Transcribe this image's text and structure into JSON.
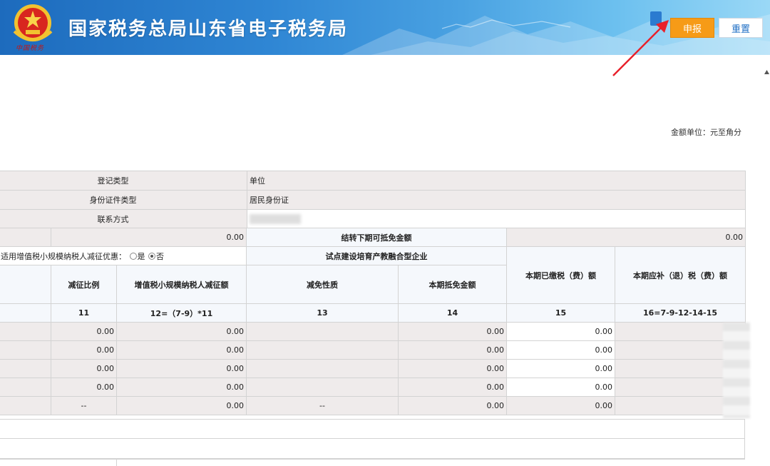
{
  "header": {
    "site_title": "国家税务总局山东省电子税务局",
    "brand_script": "中国税务",
    "submit_label": "申报",
    "reset_label": "重置"
  },
  "unit_label": "金额单位：元至角分",
  "info": {
    "rows": [
      {
        "label": "登记类型",
        "value": "单位"
      },
      {
        "label": "身份证件类型",
        "value": "居民身份证"
      },
      {
        "label": "联系方式",
        "value": ""
      }
    ]
  },
  "main": {
    "row1_value": "0.00",
    "carry_over_label": "结转下期可抵免金额",
    "carry_over_value": "0.00",
    "vat_small_label": "适用增值税小规模纳税人减征优惠：",
    "yes_label": "是",
    "no_label": "否",
    "pilot_label": "试点建设培育产教融合型企业",
    "col_headers": {
      "c11": "减征比例",
      "c12": "增值税小规模纳税人减征额",
      "c13": "减免性质",
      "c14": "本期抵免金额",
      "c15": "本期已缴税（费）额",
      "c16": "本期应补（退）税（费）额"
    },
    "col_numbers": {
      "c11": "11",
      "c12": "12=（7-9）*11",
      "c13": "13",
      "c14": "14",
      "c15": "15",
      "c16": "16=7-9-12-14-15"
    },
    "rows": [
      {
        "c11": "0.00",
        "c12": "0.00",
        "c13": "",
        "c14": "0.00",
        "c15": "0.00"
      },
      {
        "c11": "0.00",
        "c12": "0.00",
        "c13": "",
        "c14": "0.00",
        "c15": "0.00"
      },
      {
        "c11": "0.00",
        "c12": "0.00",
        "c13": "",
        "c14": "0.00",
        "c15": "0.00"
      },
      {
        "c11": "0.00",
        "c12": "0.00",
        "c13": "",
        "c14": "0.00",
        "c15": "0.00"
      },
      {
        "c11": "--",
        "c12": "0.00",
        "c13": "--",
        "c14": "0.00",
        "c15": "0.00"
      }
    ]
  },
  "colors": {
    "header_blue": "#2f86d4",
    "submit_orange": "#f69b17",
    "arrow_red": "#e8212b",
    "readonly_gray": "#efebeb"
  },
  "icons": [
    "national-tax-emblem-icon",
    "red-arrow-icon",
    "radio-icon"
  ]
}
